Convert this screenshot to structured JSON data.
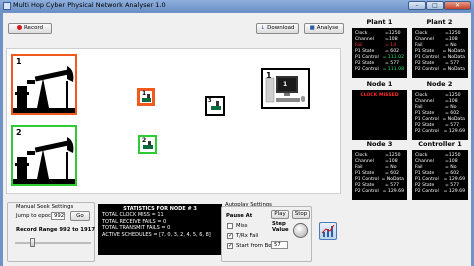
{
  "window": {
    "title": "Multi Hop Cyber Physical Network Analyser 1.0",
    "min": "–",
    "max": "□",
    "close": "✕"
  },
  "toolbar": {
    "record": "Record",
    "download": "Download",
    "analyse": "Analyse"
  },
  "nodes_canvas": {
    "pump_top": "1",
    "pump_bottom": "2",
    "orange_node": "1",
    "green_node": "2",
    "black_node": "3",
    "controller_node": "1",
    "controller_device": "1"
  },
  "panels": {
    "plant1": {
      "title": "Plant 1",
      "rows": [
        {
          "k": "Clock",
          "v": "=1250"
        },
        {
          "k": "Channel",
          "v": "=108"
        },
        {
          "k": "Fail",
          "v": "= 14"
        },
        {
          "k": "P1 State",
          "v": "= 602"
        },
        {
          "k": "P1 Control",
          "v": "= 111.02"
        },
        {
          "k": "P2 State",
          "v": "= 577"
        },
        {
          "k": "P2 Control",
          "v": "= 111.08"
        }
      ]
    },
    "plant2": {
      "title": "Plant 2",
      "rows": [
        {
          "k": "Clock",
          "v": "=1250"
        },
        {
          "k": "Channel",
          "v": "=108"
        },
        {
          "k": "Fail",
          "v": "= No"
        },
        {
          "k": "P1 State",
          "v": "= NoData"
        },
        {
          "k": "P1 Control",
          "v": "= NoData"
        },
        {
          "k": "P2 State",
          "v": "= 577"
        },
        {
          "k": "P2 Control",
          "v": "= NoData"
        }
      ]
    },
    "node1": {
      "title": "Node 1",
      "missed": "CLOCK MISSED"
    },
    "node2": {
      "title": "Node 2",
      "rows": [
        {
          "k": "Clock",
          "v": "=1250"
        },
        {
          "k": "Channel",
          "v": "=108"
        },
        {
          "k": "Fail",
          "v": "= No"
        },
        {
          "k": "P1 State",
          "v": "= 602"
        },
        {
          "k": "P1 Control",
          "v": "= NoData"
        },
        {
          "k": "P2 State",
          "v": "= 577"
        },
        {
          "k": "P2 Control",
          "v": "= 129.69"
        }
      ]
    },
    "node3": {
      "title": "Node 3",
      "rows": [
        {
          "k": "Clock",
          "v": "=1250"
        },
        {
          "k": "Channel",
          "v": "=108"
        },
        {
          "k": "Fail",
          "v": "= No"
        },
        {
          "k": "P1 State",
          "v": "= 602"
        },
        {
          "k": "P1 Control",
          "v": "= NoData"
        },
        {
          "k": "P2 State",
          "v": "= 577"
        },
        {
          "k": "P2 Control",
          "v": "= 129.69"
        }
      ]
    },
    "controller1": {
      "title": "Controller 1",
      "rows": [
        {
          "k": "Clock",
          "v": "=1250"
        },
        {
          "k": "Channel",
          "v": "=108"
        },
        {
          "k": "Fail",
          "v": "= No"
        },
        {
          "k": "P1 State",
          "v": "= 602"
        },
        {
          "k": "P1 Control",
          "v": "= 129.69"
        },
        {
          "k": "P2 State",
          "v": "= 577"
        },
        {
          "k": "P2 Control",
          "v": "= 129.69"
        }
      ]
    }
  },
  "manual_seek": {
    "title": "Manual Seek Settings",
    "jump_label": "Jump to epoch",
    "jump_value": "992",
    "go": "Go",
    "range_label": "Record Range 992 to 1917",
    "slider_fraction": 0.22
  },
  "stats": {
    "title": "STATISTICS FOR NODE # 3",
    "lines": [
      "TOTAL CLOCK MISS = 11",
      "TOTAL RECEIVE FAILS = 0",
      "TOTAL TRANSMIT FAILS = 0",
      "ACTIVE SCHEDULES = [7, 0, 3, 2, 4, 5, 6, 8]"
    ]
  },
  "autoplay": {
    "title": "Autoplay Settings",
    "pause_at": "Pause At",
    "miss": "Miss",
    "txrx_fail": "T/Rx Fail",
    "start_begin": "Start from Begin",
    "play": "Play",
    "stop": "Stop",
    "step_value_label": "Step Value",
    "step_value": "57",
    "miss_checked": false,
    "txrx_checked": true,
    "start_checked": true
  },
  "colors": {
    "orange": "#f05a1e",
    "green": "#2fcb34",
    "accent_red": "#d21a1a"
  },
  "icons": [
    "record-dot-icon",
    "download-icon",
    "analyse-icon",
    "chart-icon",
    "knob-icon"
  ]
}
